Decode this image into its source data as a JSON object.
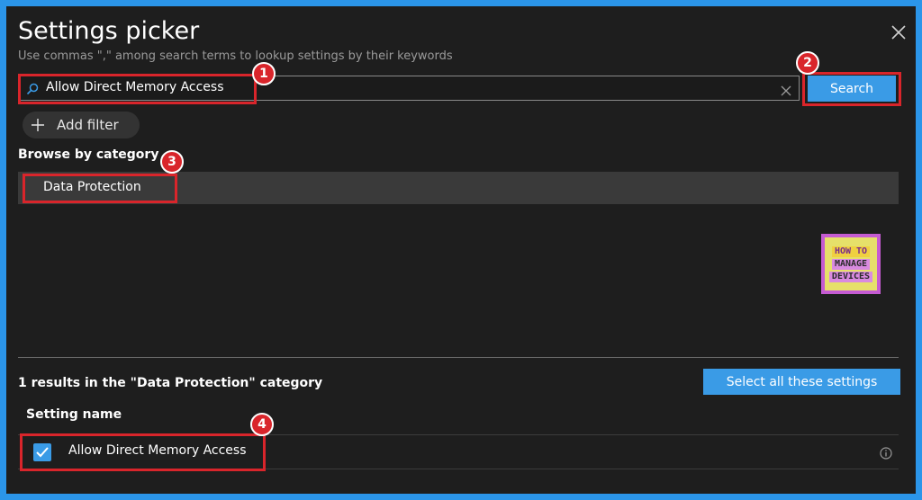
{
  "dialog": {
    "title": "Settings picker",
    "subtitle": "Use commas \",\" among search terms to lookup settings by their keywords",
    "close_icon": "close-icon"
  },
  "search": {
    "value": "Allow Direct Memory Access",
    "button_label": "Search"
  },
  "filter": {
    "add_label": "Add filter"
  },
  "browse": {
    "heading": "Browse by category",
    "categories": [
      {
        "label": "Data Protection",
        "selected": true
      }
    ]
  },
  "logo": {
    "line1": "HOW TO",
    "line2": "MANAGE",
    "line3": "DEVICES"
  },
  "results": {
    "summary": "1 results in the \"Data Protection\" category",
    "select_all_label": "Select all these settings",
    "column_header": "Setting name",
    "rows": [
      {
        "name": "Allow Direct Memory Access",
        "checked": true
      }
    ]
  },
  "annotations": [
    "1",
    "2",
    "3",
    "4"
  ],
  "colors": {
    "accent": "#3a9be6",
    "highlight": "#d9252b",
    "background": "#1e1e1e",
    "frame": "#2b95e9"
  }
}
